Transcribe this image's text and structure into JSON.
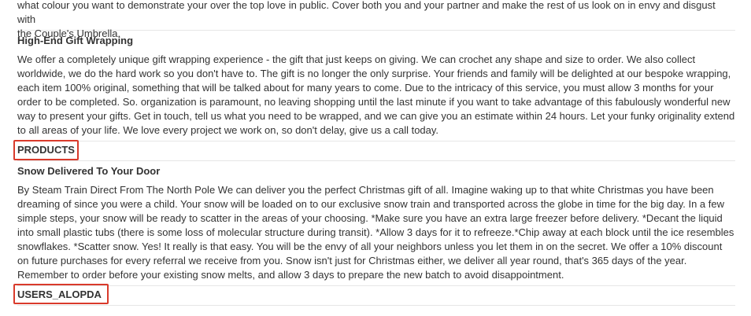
{
  "intro": {
    "text_line1": "what colour you want to demonstrate your over the top love in public. Cover both you and your partner and make the rest of us look on in envy and disgust with",
    "text_line2": "the Couple's Umbrella."
  },
  "gift_wrapping": {
    "title": "High-End Gift Wrapping",
    "body": "We offer a completely unique gift wrapping experience - the gift that just keeps on giving. We can crochet any shape and size to order. We also collect worldwide, we do the hard work so you don't have to. The gift is no longer the only surprise. Your friends and family will be delighted at our bespoke wrapping, each item 100% original, something that will be talked about for many years to come. Due to the intricacy of this service, you must allow 3 months for your order to be completed. So. organization is paramount, no leaving shopping until the last minute if you want to take advantage of this fabulously wonderful new way to present your gifts. Get in touch, tell us what you need to be wrapped, and we can give you an estimate within 24 hours. Let your funky originality extend to all areas of your life. We love every project we work on, so don't delay, give us a call today."
  },
  "products_section": {
    "label": "PRODUCTS"
  },
  "snow": {
    "title": "Snow Delivered To Your Door",
    "body": "By Steam Train Direct From The North Pole We can deliver you the perfect Christmas gift of all. Imagine waking up to that white Christmas you have been dreaming of since you were a child. Your snow will be loaded on to our exclusive snow train and transported across the globe in time for the big day. In a few simple steps, your snow will be ready to scatter in the areas of your choosing. *Make sure you have an extra large freezer before delivery. *Decant the liquid into small plastic tubs (there is some loss of molecular structure during transit). *Allow 3 days for it to refreeze.*Chip away at each block until the ice resembles snowflakes. *Scatter snow. Yes! It really is that easy. You will be the envy of all your neighbors unless you let them in on the secret. We offer a 10% discount on future purchases for every referral we receive from you. Snow isn't just for Christmas either, we deliver all year round, that's 365 days of the year. Remember to order before your existing snow melts, and allow 3 days to prepare the new batch to avoid disappointment."
  },
  "users_section": {
    "label": "USERS_ALOPDA"
  },
  "colors": {
    "highlight": "#d93a2b",
    "text": "#333333",
    "divider": "#e6e6e6"
  }
}
